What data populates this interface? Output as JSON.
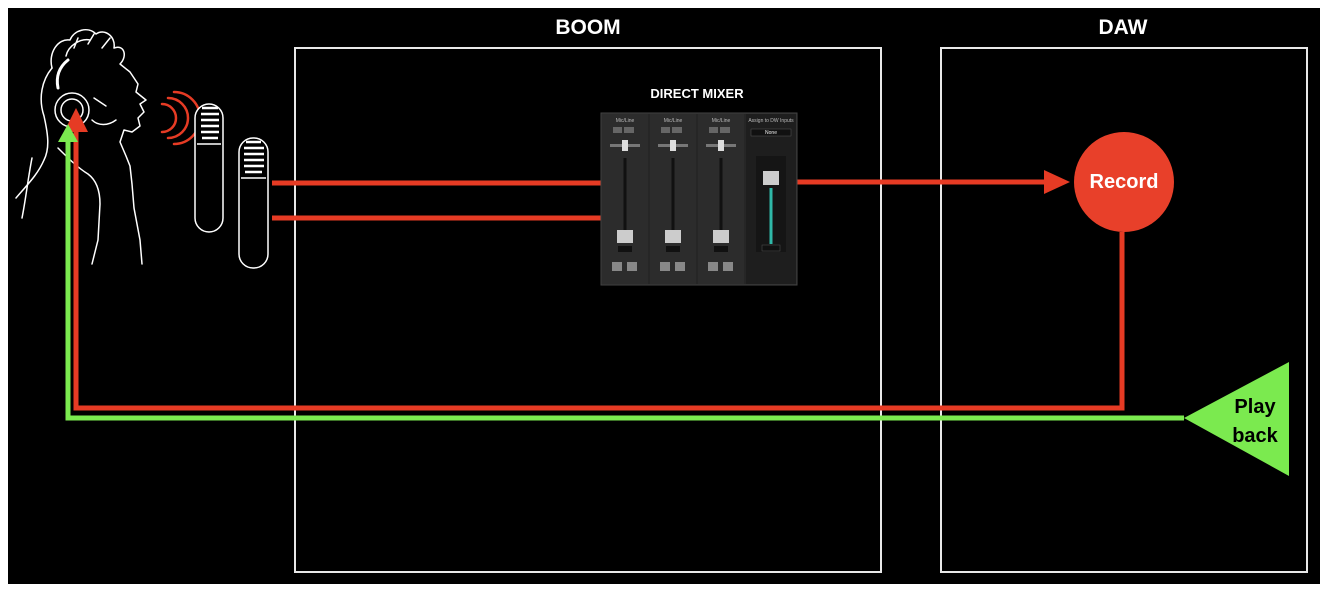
{
  "boom": {
    "title": "BOOM"
  },
  "daw": {
    "title": "DAW"
  },
  "mixer": {
    "title": "DIRECT MIXER",
    "channel_labels": [
      "Mic/Line",
      "Mic/Line",
      "Mic/Line"
    ],
    "master_label": "Assign to DW Inputs",
    "master_select": "None"
  },
  "record": {
    "label": "Record"
  },
  "playback": {
    "label_line1": "Play",
    "label_line2": "back"
  },
  "colors": {
    "background": "#000000",
    "box_border": "#e8e8e8",
    "signal_red": "#e63b24",
    "playback_green": "#7bea4f",
    "record_fill": "#e8402a",
    "fader_teal": "#2fb8a8"
  },
  "icons": [
    "singer-with-headphones-icon",
    "sound-waves-icon",
    "microphone-icon"
  ]
}
